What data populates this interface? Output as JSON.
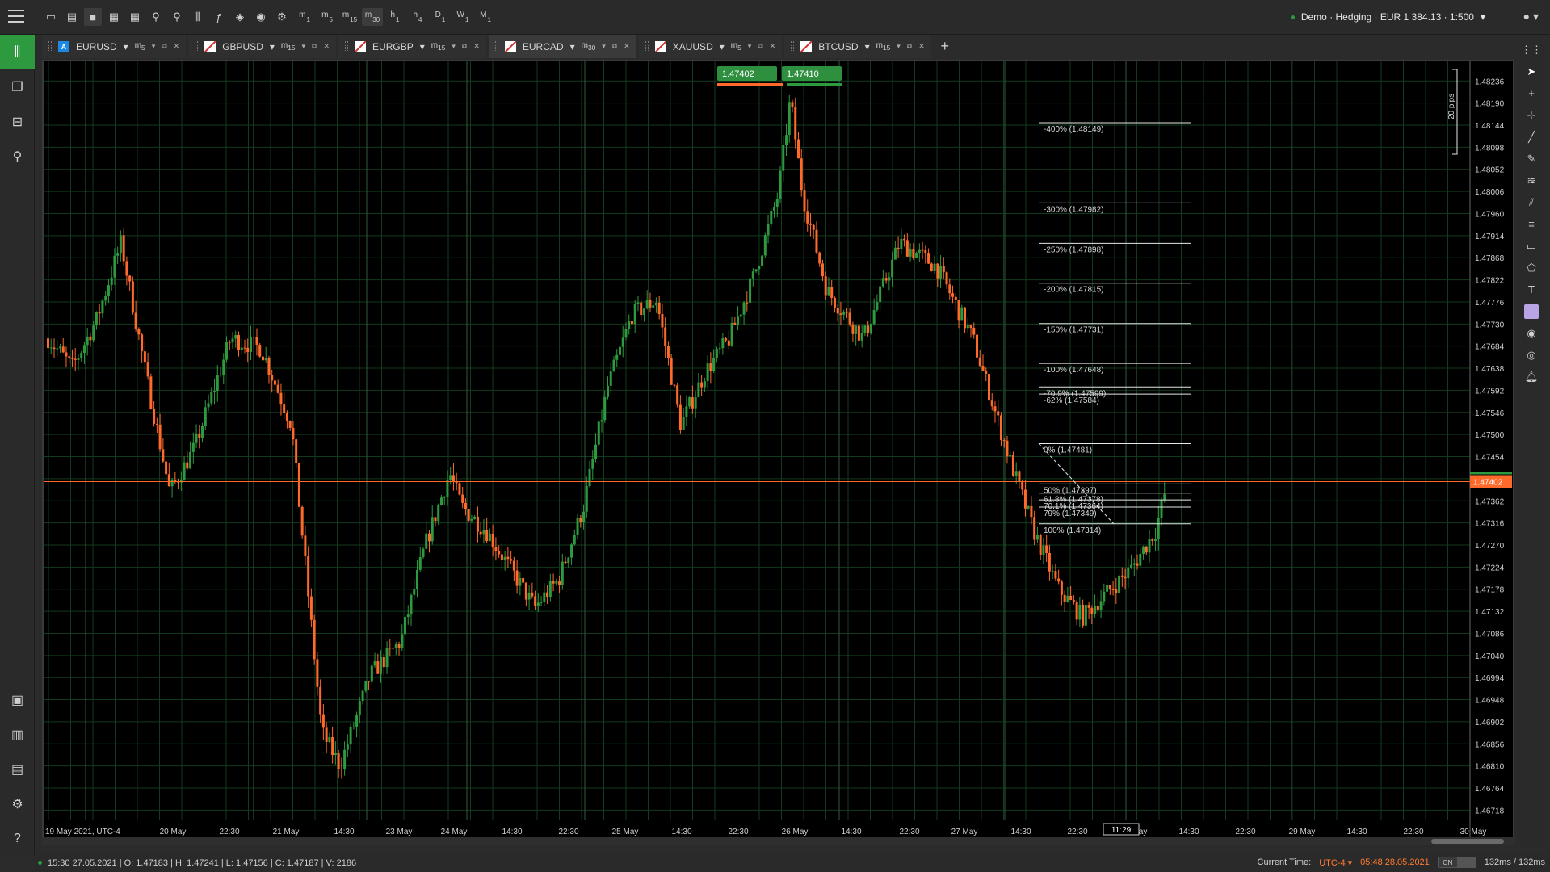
{
  "topbar": {
    "menu_icon": "hamburger-icon",
    "timeframes": [
      {
        "main": "m",
        "sub": "1"
      },
      {
        "main": "m",
        "sub": "5"
      },
      {
        "main": "m",
        "sub": "15"
      },
      {
        "main": "m",
        "sub": "30"
      },
      {
        "main": "h",
        "sub": "1"
      },
      {
        "main": "h",
        "sub": "4"
      },
      {
        "main": "D",
        "sub": "1"
      },
      {
        "main": "W",
        "sub": "1"
      },
      {
        "main": "M",
        "sub": "1"
      }
    ],
    "account_text": "Demo · Hedging · EUR 1 384.13 · 1:500"
  },
  "tabs": [
    {
      "symbol": "EURUSD",
      "flag": "A",
      "timeframe": "m",
      "tf_sub": "5",
      "active": false
    },
    {
      "symbol": "GBPUSD",
      "flag": "",
      "timeframe": "m",
      "tf_sub": "15",
      "active": false
    },
    {
      "symbol": "EURGBP",
      "flag": "",
      "timeframe": "m",
      "tf_sub": "15",
      "active": false
    },
    {
      "symbol": "EURCAD",
      "flag": "",
      "timeframe": "m",
      "tf_sub": "30",
      "active": true
    },
    {
      "symbol": "XAUUSD",
      "flag": "",
      "timeframe": "m",
      "tf_sub": "5",
      "active": false
    },
    {
      "symbol": "BTCUSD",
      "flag": "",
      "timeframe": "m",
      "tf_sub": "15",
      "active": false
    }
  ],
  "quick_trade": {
    "sell": "1.47402",
    "buy": "1.47410"
  },
  "pips_label": "20 pips",
  "chart_data": {
    "type": "candlestick",
    "symbol": "EURCAD",
    "timeframe": "m30",
    "y_ticks": [
      "1.48236",
      "1.48190",
      "1.48144",
      "1.48098",
      "1.48052",
      "1.48006",
      "1.47960",
      "1.47914",
      "1.47868",
      "1.47822",
      "1.47776",
      "1.47730",
      "1.47684",
      "1.47638",
      "1.47592",
      "1.47546",
      "1.47500",
      "1.47454",
      "1.47408",
      "1.47362",
      "1.47316",
      "1.47270",
      "1.47224",
      "1.47178",
      "1.47132",
      "1.47086",
      "1.47040",
      "1.46994",
      "1.46948",
      "1.46902",
      "1.46856",
      "1.46810",
      "1.46764",
      "1.46718"
    ],
    "ylim": [
      1.4668,
      1.4826
    ],
    "current_price": "1.47402",
    "x_ticks": [
      "19 May 2021, UTC-4",
      "20 May",
      "22:30",
      "21 May",
      "14:30",
      "23 May",
      "24 May",
      "14:30",
      "22:30",
      "25 May",
      "14:30",
      "22:30",
      "26 May",
      "14:30",
      "22:30",
      "27 May",
      "14:30",
      "22:30",
      "28 May",
      "14:30",
      "22:30",
      "29 May",
      "14:30",
      "22:30",
      "30 May"
    ],
    "cursor_time": "11:29",
    "fib_levels": [
      {
        "label": "-400% (1.48149)",
        "price": 1.48149
      },
      {
        "label": "-300% (1.47982)",
        "price": 1.47982
      },
      {
        "label": "-250% (1.47898)",
        "price": 1.47898
      },
      {
        "label": "-200% (1.47815)",
        "price": 1.47815
      },
      {
        "label": "-150% (1.47731)",
        "price": 1.47731
      },
      {
        "label": "-100% (1.47648)",
        "price": 1.47648
      },
      {
        "label": "-70.9% (1.47599)",
        "price": 1.47599
      },
      {
        "label": "-62% (1.47584)",
        "price": 1.47584
      },
      {
        "label": "0% (1.47481)",
        "price": 1.47481
      },
      {
        "label": "50% (1.47397)",
        "price": 1.47397
      },
      {
        "label": "61.8% (1.47378)",
        "price": 1.47378
      },
      {
        "label": "70.1% (1.47364)",
        "price": 1.47364
      },
      {
        "label": "79% (1.47349)",
        "price": 1.47349
      },
      {
        "label": "100% (1.47314)",
        "price": 1.47314
      }
    ],
    "colors": {
      "up": "#2e9a3f",
      "down": "#ff6a2b",
      "grid": "#123a1e",
      "current": "#ff6a2b"
    }
  },
  "status": {
    "ohlc": "15:30 27.05.2021 | O: 1.47183 | H: 1.47241 | L: 1.47156 | C: 1.47187 | V: 2186",
    "current_time_label": "Current Time:",
    "timezone": "UTC-4 ▾",
    "clock": "05:48 28.05.2021",
    "toggle_on": "ON",
    "latency": "132ms / 132ms"
  }
}
